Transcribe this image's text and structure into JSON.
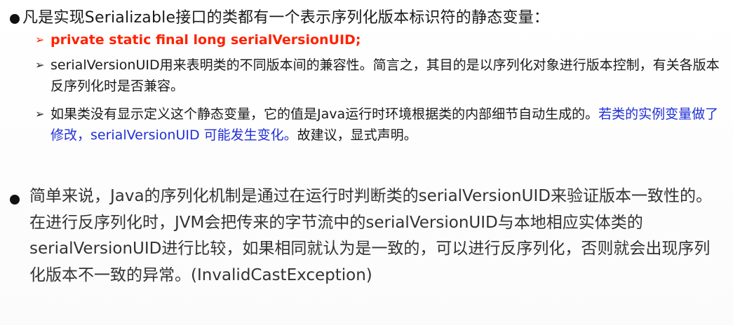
{
  "bullet1": {
    "heading": "凡是实现Serializable接口的类都有一个表示序列化版本标识符的静态变量："
  },
  "sub_marker": "➢",
  "subs": [
    {
      "code": "private static final long serialVersionUID;"
    },
    {
      "text": "serialVersionUID用来表明类的不同版本间的兼容性。简言之，其目的是以序列化对象进行版本控制，有关各版本反序列化时是否兼容。"
    },
    {
      "text_before": "如果类没有显示定义这个静态变量，它的值是Java运行时环境根据类的内部细节自动生成的。",
      "highlight": "若类的实例变量做了修改，serialVersionUID 可能发生变化。",
      "text_after": "故建议，显式声明。"
    }
  ],
  "bullet2": {
    "text": "简单来说，Java的序列化机制是通过在运行时判断类的serialVersionUID来验证版本一致性的。在进行反序列化时，JVM会把传来的字节流中的serialVersionUID与本地相应实体类的serialVersionUID进行比较，如果相同就认为是一致的，可以进行反序列化，否则就会出现序列化版本不一致的异常。(InvalidCastException)"
  },
  "colors": {
    "code_red": "#ff2200",
    "highlight_blue": "#1f2fd6",
    "text": "#1a1a1a",
    "background": "#ffffff"
  }
}
